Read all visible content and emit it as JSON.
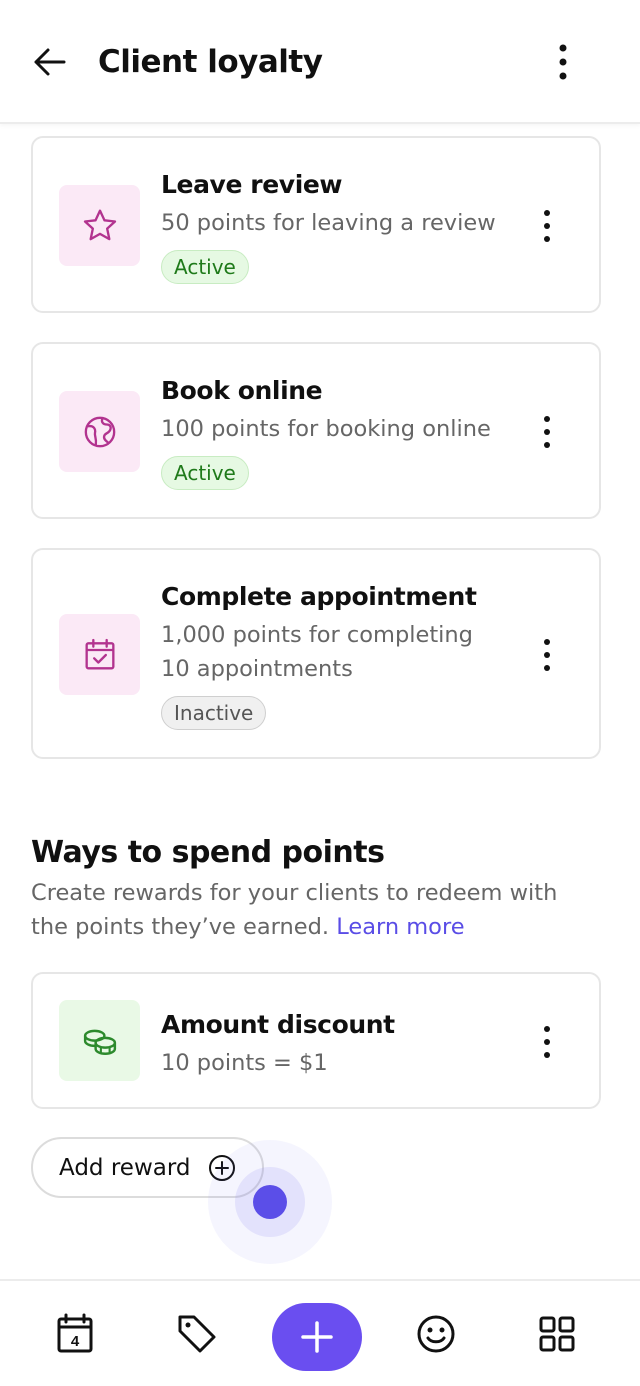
{
  "header": {
    "title": "Client loyalty",
    "back_icon": "arrow-left-icon",
    "menu_icon": "more-vertical-icon"
  },
  "earn": {
    "items": [
      {
        "title": "Leave review",
        "description": "50 points for leaving a review",
        "status": "Active",
        "icon": "star-icon"
      },
      {
        "title": "Book online",
        "description": "100 points for booking online",
        "status": "Active",
        "icon": "globe-icon"
      },
      {
        "title": "Complete appointment",
        "description": "1,000 points for completing 10 appointments",
        "status": "Inactive",
        "icon": "calendar-check-icon"
      }
    ]
  },
  "spend": {
    "title": "Ways to spend points",
    "description": "Create rewards for your clients to redeem with the points they’ve earned.",
    "learn_more": "Learn more",
    "items": [
      {
        "title": "Amount discount",
        "description": "10 points = $1",
        "icon": "coins-icon"
      }
    ],
    "add_reward_label": "Add reward"
  },
  "bottom_nav": {
    "calendar_day": "4",
    "items": [
      "calendar-icon",
      "tag-icon",
      "add-icon",
      "smiley-icon",
      "grid-icon"
    ]
  },
  "colors": {
    "accent": "#6a4ef0",
    "link": "#5a4de6",
    "active_badge_text": "#1f7a1a",
    "pink_icon": "#b2338f",
    "green_icon": "#2d8a2d"
  }
}
